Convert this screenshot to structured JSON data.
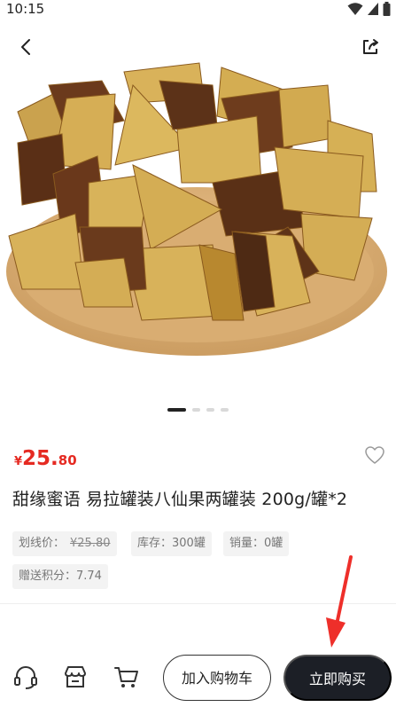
{
  "status_bar": {
    "time": "10:15"
  },
  "nav": {
    "back_icon": "chevron-left-icon",
    "share_icon": "share-icon"
  },
  "gallery": {
    "dot_count": 4,
    "active_index": 0
  },
  "product": {
    "price_symbol": "¥",
    "price_integer": "25.",
    "price_decimal": "80",
    "title": "甜缘蜜语 易拉罐装八仙果两罐装 200g/罐*2",
    "tags": [
      {
        "label": "划线价：",
        "value": "¥25.80"
      },
      {
        "label": "库存：300罐"
      },
      {
        "label": "销量：0罐"
      },
      {
        "label": "赠送积分：7.74"
      }
    ]
  },
  "bottom_bar": {
    "icons": [
      "customer-service-icon",
      "store-icon",
      "cart-icon"
    ],
    "add_to_cart_label": "加入购物车",
    "buy_now_label": "立即购买"
  },
  "colors": {
    "price": "#e52a22",
    "buy_button": "#1c1f26",
    "annotation_arrow": "#ee2f2a"
  }
}
